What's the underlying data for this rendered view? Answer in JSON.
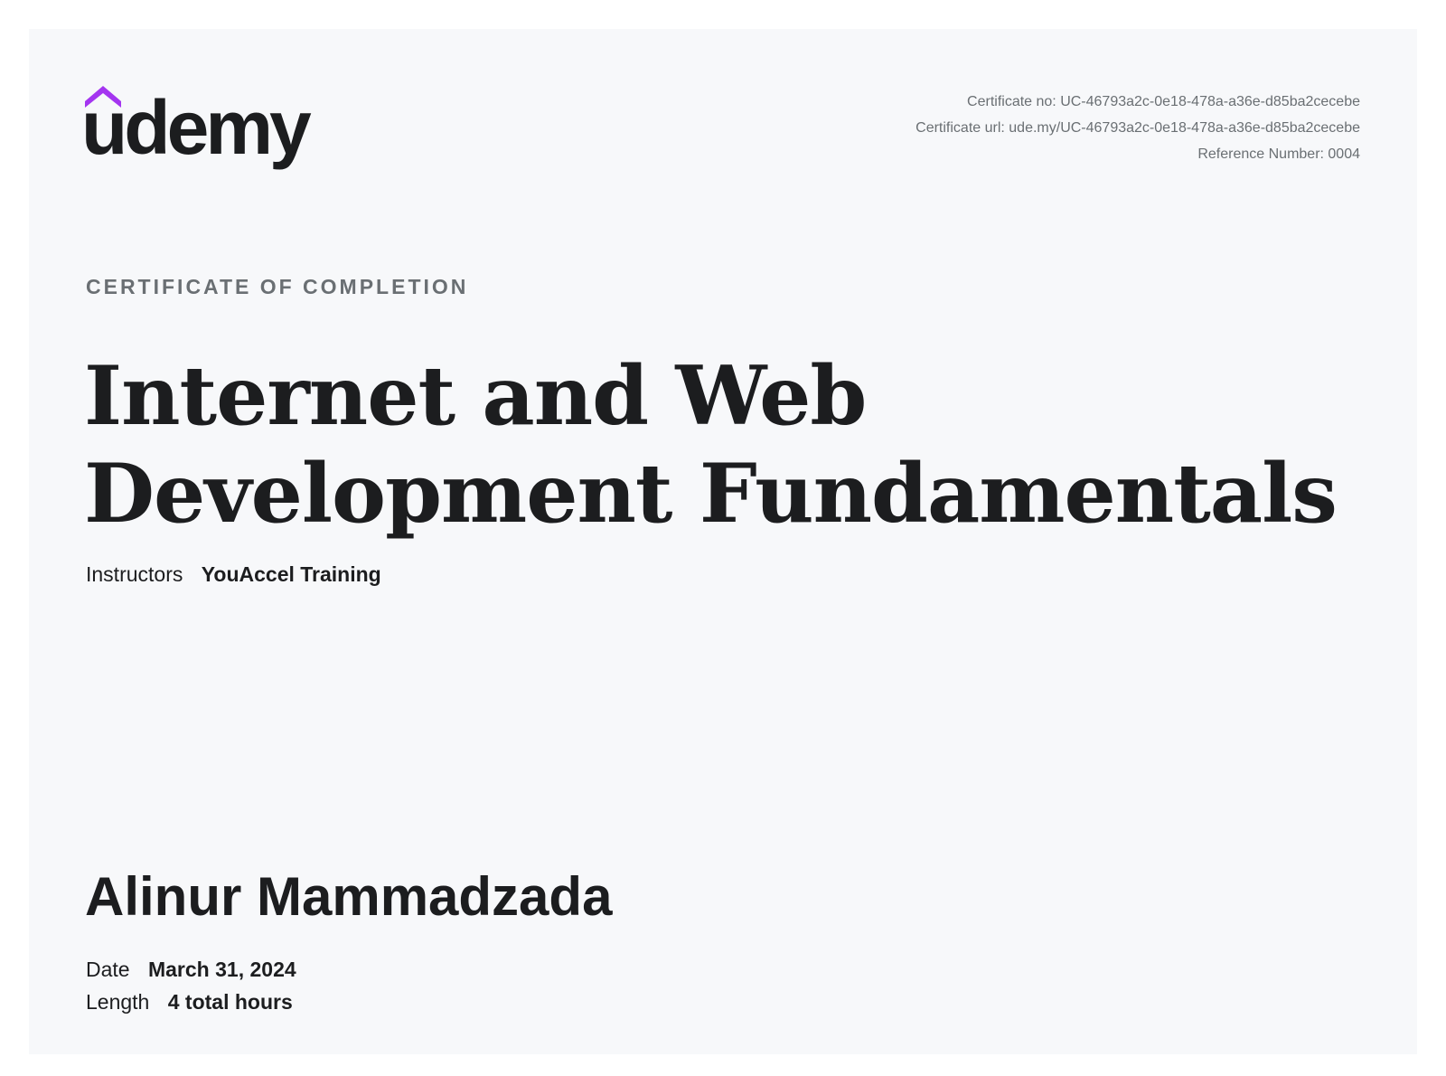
{
  "brand": {
    "logo_text": "udemy",
    "accent_color": "#a435f0"
  },
  "certificate_meta": {
    "number_line": "Certificate no: UC-46793a2c-0e18-478a-a36e-d85ba2cecebe",
    "url_line": "Certificate url: ude.my/UC-46793a2c-0e18-478a-a36e-d85ba2cecebe",
    "reference_line": "Reference Number: 0004"
  },
  "heading": {
    "eyebrow": "CERTIFICATE OF COMPLETION",
    "course_title": "Internet and Web Development Fundamentals"
  },
  "instructors": {
    "label": "Instructors",
    "value": "YouAccel Training"
  },
  "recipient": {
    "name": "Alinur Mammadzada"
  },
  "details": {
    "date_label": "Date",
    "date_value": "March 31, 2024",
    "length_label": "Length",
    "length_value": "4 total hours"
  }
}
